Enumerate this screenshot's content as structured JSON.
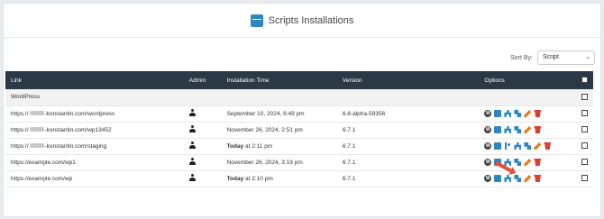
{
  "header": {
    "title": "Scripts Installations",
    "icon": "box-icon"
  },
  "sort": {
    "label": "Sort By:",
    "value": "Script"
  },
  "table": {
    "columns": [
      "Link",
      "Admin",
      "Installation Time",
      "Version",
      "Options"
    ],
    "group": "WordPress",
    "rows": [
      {
        "link_prefix": "https://",
        "link_suffix": "-konstantin.com/wordpress",
        "time_bold": "",
        "time": "September 10, 2024, 6:49 pm",
        "version": "6.8-alpha-59356"
      },
      {
        "link_prefix": "https://",
        "link_suffix": "-konstantin.com/wp13452",
        "time_bold": "",
        "time": "November 26, 2024, 2:51 pm",
        "version": "6.7.1"
      },
      {
        "link_prefix": "https://",
        "link_suffix": "-konstantin.com/staging",
        "time_bold": "Today",
        "time": " at 2:11 pm",
        "version": "6.7.1"
      },
      {
        "link_prefix": "https://example.com/wp1",
        "link_suffix": "",
        "time_bold": "",
        "time": "November 26, 2024, 3:19 pm",
        "version": "6.7.1"
      },
      {
        "link_prefix": "https://example.com/wp",
        "link_suffix": "",
        "time_bold": "Today",
        "time": " at 2:10 pm",
        "version": "6.7.1"
      }
    ]
  },
  "colors": {
    "header_bg": "#2b3846",
    "accent": "#2e86c1",
    "edit": "#e67e22",
    "delete": "#e03c31",
    "arrow": "#e74c3c"
  }
}
